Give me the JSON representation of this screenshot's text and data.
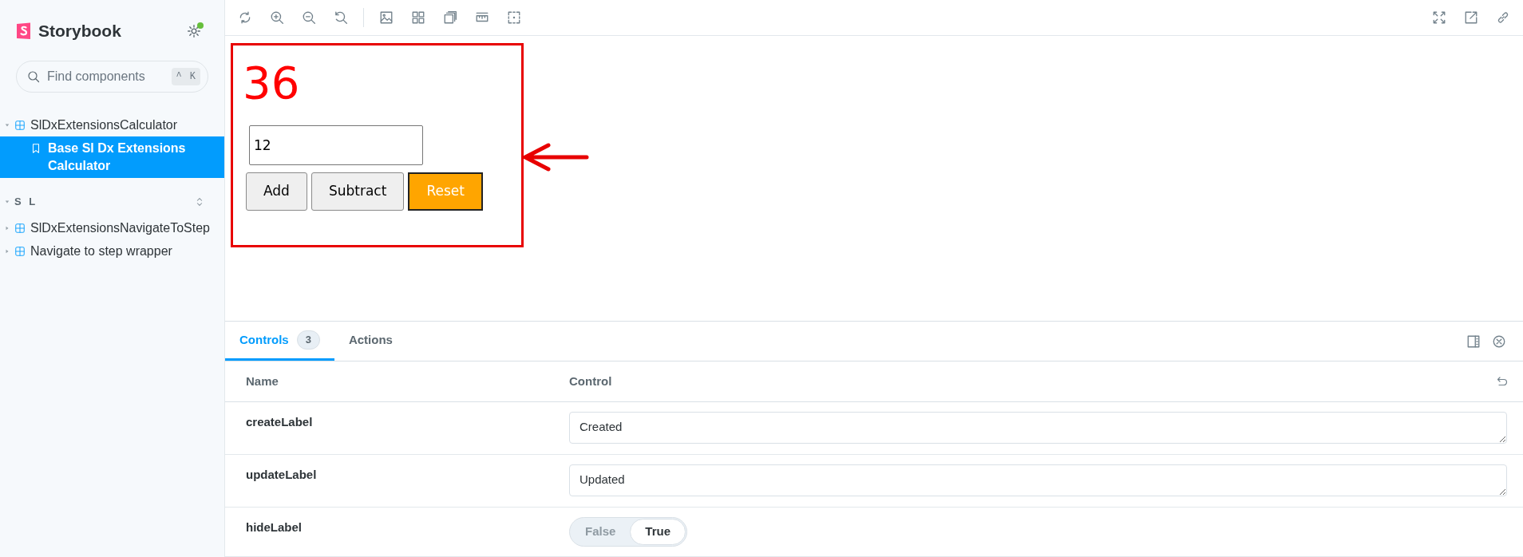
{
  "sidebar": {
    "brand": "Storybook",
    "search": {
      "placeholder": "Find components",
      "shortcut": [
        "^",
        "K"
      ]
    },
    "tree": [
      {
        "kind": "component",
        "label": "SlDxExtensionsCalculator",
        "expanded": true,
        "children": [
          {
            "kind": "story",
            "label": "Base Sl Dx Extensions Calculator",
            "selected": true
          }
        ]
      },
      {
        "kind": "section",
        "label": "S L",
        "expanded": true,
        "children": [
          {
            "kind": "component",
            "label": "SlDxExtensionsNavigateToStep",
            "expanded": false
          },
          {
            "kind": "component",
            "label": "Navigate to step wrapper",
            "expanded": false
          }
        ]
      }
    ]
  },
  "preview": {
    "result": "36",
    "input_value": "12",
    "buttons": [
      {
        "label": "Add",
        "primary": false
      },
      {
        "label": "Subtract",
        "primary": false
      },
      {
        "label": "Reset",
        "primary": true
      }
    ]
  },
  "panel": {
    "tabs": [
      {
        "label": "Controls",
        "count": "3",
        "selected": true
      },
      {
        "label": "Actions",
        "selected": false
      }
    ],
    "columns": [
      "Name",
      "Control"
    ],
    "rows": [
      {
        "name": "createLabel",
        "kind": "text",
        "value": "Created"
      },
      {
        "name": "updateLabel",
        "kind": "text",
        "value": "Updated"
      },
      {
        "name": "hideLabel",
        "kind": "boolean",
        "options": [
          {
            "label": "False",
            "selected": false
          },
          {
            "label": "True",
            "selected": true
          }
        ]
      }
    ]
  }
}
